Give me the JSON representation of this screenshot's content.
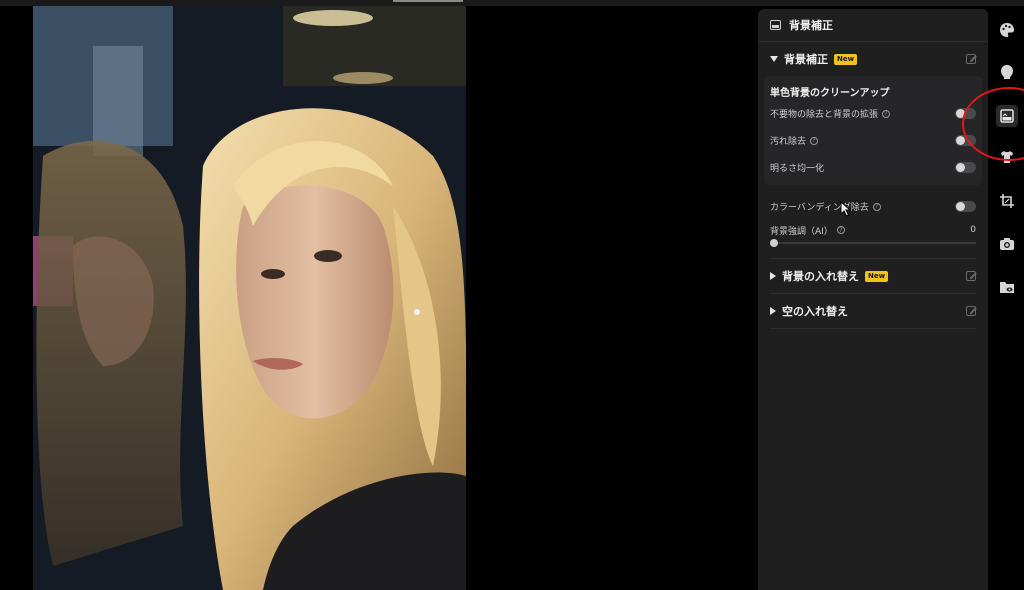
{
  "header": {
    "title": "背景補正"
  },
  "section_bg": {
    "label": "背景補正",
    "badge": "New",
    "subcard_title": "単色背景のクリーンアップ",
    "rows": [
      {
        "label": "不要物の除去と背景の拡張",
        "help": "?"
      },
      {
        "label": "汚れ除去",
        "help": "?"
      },
      {
        "label": "明るさ均一化"
      }
    ],
    "banding": {
      "label": "カラーバンディング除去",
      "help": "?"
    },
    "slider": {
      "label": "背景強調（AI）",
      "help": "?",
      "value": "0"
    }
  },
  "section_replace": {
    "label": "背景の入れ替え",
    "badge": "New"
  },
  "section_sky": {
    "label": "空の入れ替え"
  },
  "rail_icons": [
    "palette-icon",
    "face-icon",
    "background-icon",
    "shirt-icon",
    "crop-icon",
    "camera-icon",
    "folder-eye-icon"
  ],
  "colors": {
    "accent_badge": "#f2c21b",
    "panel_bg": "#1f1f20",
    "annotation": "#e01818"
  }
}
